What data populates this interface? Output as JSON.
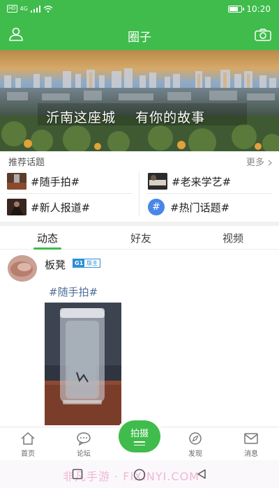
{
  "status_bar": {
    "network": "4G",
    "time": "10:20"
  },
  "header": {
    "title": "圈子",
    "left_icon": "user-icon",
    "right_icon": "camera-icon",
    "color": "#3fbc4c"
  },
  "banner": {
    "caption": "沂南这座城    有你的故事"
  },
  "topics": {
    "label": "推荐话题",
    "more": "更多",
    "items": [
      {
        "label": "#随手拍#"
      },
      {
        "label": "#老来学艺#"
      },
      {
        "label": "#新人报道#"
      },
      {
        "label": "#热门话题#"
      }
    ]
  },
  "tabs": [
    {
      "label": "动态",
      "active": true
    },
    {
      "label": "好友",
      "active": false
    },
    {
      "label": "视频",
      "active": false
    }
  ],
  "post": {
    "username": "板凳",
    "badge_level": "G1",
    "badge_role": "版主",
    "tag": "#随手拍#"
  },
  "bottom_nav": {
    "items": [
      {
        "label": "首页",
        "icon": "home-icon"
      },
      {
        "label": "论坛",
        "icon": "chat-bubble-icon"
      },
      {
        "label": "拍摄",
        "icon": "shoot-icon"
      },
      {
        "label": "发现",
        "icon": "compass-icon"
      },
      {
        "label": "消息",
        "icon": "mail-icon"
      }
    ]
  },
  "watermark": "非凡手游 · FIXINYI.COM"
}
